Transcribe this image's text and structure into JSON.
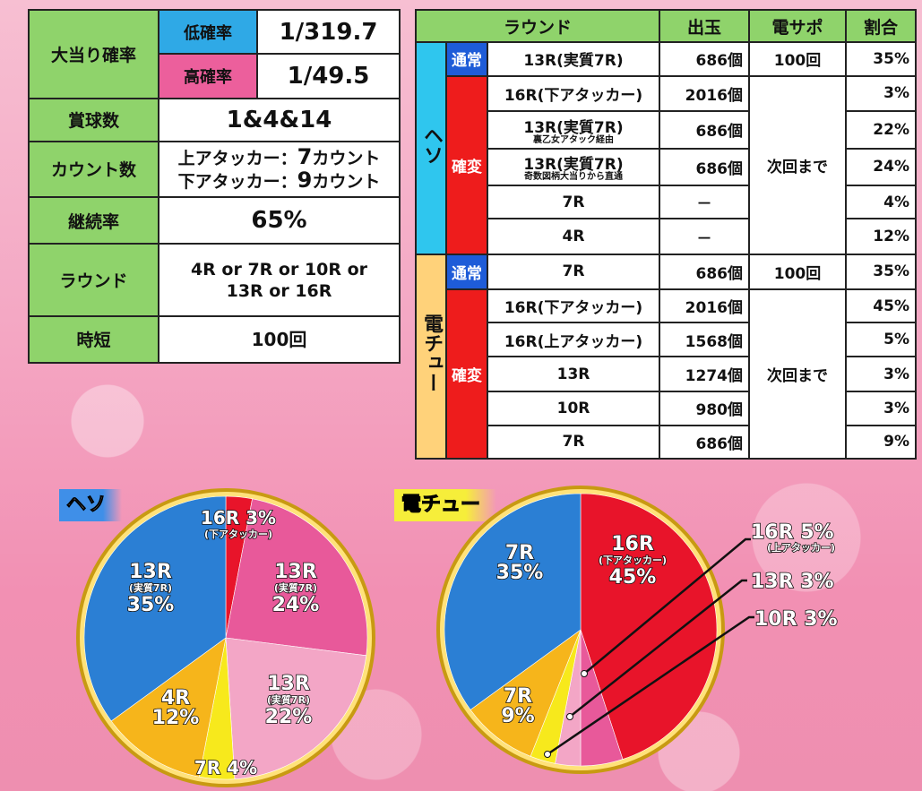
{
  "spec": {
    "jackpot_label": "大当り確率",
    "low_label": "低確率",
    "low_value": "1/319.7",
    "high_label": "高確率",
    "high_value": "1/49.5",
    "prize_label": "賞球数",
    "prize_value": "1&4&14",
    "count_label": "カウント数",
    "count_upper_label": "上アタッカー：",
    "count_upper_value": "7",
    "count_upper_unit": "カウント",
    "count_lower_label": "下アタッカー：",
    "count_lower_value": "9",
    "count_lower_unit": "カウント",
    "continue_label": "継続率",
    "continue_value": "65%",
    "round_label": "ラウンド",
    "round_value_1": "4R or 7R or 10R or",
    "round_value_2": "13R or 16R",
    "jitan_label": "時短",
    "jitan_value": "100回"
  },
  "dist": {
    "headers": [
      "ラウンド",
      "出玉",
      "電サポ",
      "割合"
    ],
    "heso_label": "ヘソ",
    "den_label": "電チュー",
    "normal_label": "通常",
    "kakuhen_label": "確変",
    "next_label": "次回まで",
    "heso_rows": [
      {
        "round": "13R(実質7R)",
        "note": "",
        "out": "686個",
        "support": "100回",
        "pct": "35%"
      },
      {
        "round": "16R(下アタッカー)",
        "note": "",
        "out": "2016個",
        "support": "",
        "pct": "3%"
      },
      {
        "round": "13R(実質7R)",
        "note": "裏乙女アタック経由",
        "out": "686個",
        "support": "",
        "pct": "22%"
      },
      {
        "round": "13R(実質7R)",
        "note": "奇数図柄大当りから直通",
        "out": "686個",
        "support": "",
        "pct": "24%"
      },
      {
        "round": "7R",
        "note": "",
        "out": "－",
        "support": "",
        "pct": "4%"
      },
      {
        "round": "4R",
        "note": "",
        "out": "－",
        "support": "",
        "pct": "12%"
      }
    ],
    "den_rows": [
      {
        "round": "7R",
        "out": "686個",
        "support": "100回",
        "pct": "35%"
      },
      {
        "round": "16R(下アタッカー)",
        "out": "2016個",
        "support": "",
        "pct": "45%"
      },
      {
        "round": "16R(上アタッカー)",
        "out": "1568個",
        "support": "",
        "pct": "5%"
      },
      {
        "round": "13R",
        "out": "1274個",
        "support": "",
        "pct": "3%"
      },
      {
        "round": "10R",
        "out": "980個",
        "support": "",
        "pct": "3%"
      },
      {
        "round": "7R",
        "out": "686個",
        "support": "",
        "pct": "9%"
      }
    ]
  },
  "chart_data": [
    {
      "type": "pie",
      "title": "ヘソ",
      "slices": [
        {
          "label": "16R",
          "sub": "(下アタッカー)",
          "value": 3,
          "text": "3%",
          "color": "#e8142a"
        },
        {
          "label": "13R",
          "sub": "(実質7R)",
          "value": 24,
          "text": "24%",
          "color": "#e8599a"
        },
        {
          "label": "13R",
          "sub": "(実質7R)",
          "value": 22,
          "text": "22%",
          "color": "#f3a6c6"
        },
        {
          "label": "7R",
          "sub": "",
          "value": 4,
          "text": "4%",
          "color": "#f7e91c"
        },
        {
          "label": "4R",
          "sub": "",
          "value": 12,
          "text": "12%",
          "color": "#f6b51b"
        },
        {
          "label": "13R",
          "sub": "(実質7R)",
          "value": 35,
          "text": "35%",
          "color": "#2b7fd4"
        }
      ]
    },
    {
      "type": "pie",
      "title": "電チュー",
      "slices": [
        {
          "label": "16R",
          "sub": "(下アタッカー)",
          "value": 45,
          "text": "45%",
          "color": "#e8142a"
        },
        {
          "label": "16R",
          "sub": "(上アタッカー)",
          "value": 5,
          "text": "5%",
          "color": "#e8599a"
        },
        {
          "label": "13R",
          "sub": "",
          "value": 3,
          "text": "3%",
          "color": "#f3a6c6"
        },
        {
          "label": "10R",
          "sub": "",
          "value": 3,
          "text": "3%",
          "color": "#f7e91c"
        },
        {
          "label": "7R",
          "sub": "",
          "value": 9,
          "text": "9%",
          "color": "#f6b51b"
        },
        {
          "label": "7R",
          "sub": "",
          "value": 35,
          "text": "35%",
          "color": "#2b7fd4"
        }
      ]
    }
  ]
}
